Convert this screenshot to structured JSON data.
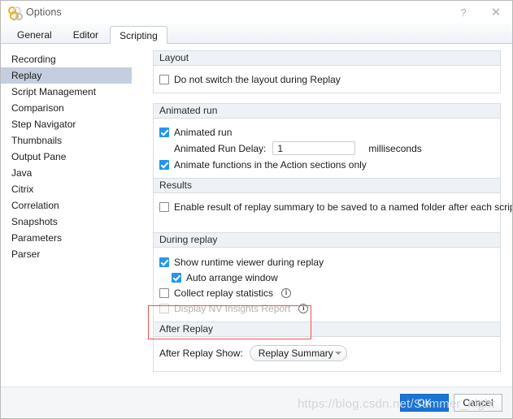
{
  "window": {
    "title": "Options",
    "icon": "vugen-rings-icon",
    "help_label": "?",
    "close_label": "✕"
  },
  "tabs": [
    {
      "label": "General",
      "active": false
    },
    {
      "label": "Editor",
      "active": false
    },
    {
      "label": "Scripting",
      "active": true
    }
  ],
  "sidebar": {
    "items": [
      {
        "label": "Recording",
        "selected": false
      },
      {
        "label": "Replay",
        "selected": true
      },
      {
        "label": "Script Management",
        "selected": false
      },
      {
        "label": "Comparison",
        "selected": false
      },
      {
        "label": "Step Navigator",
        "selected": false
      },
      {
        "label": "Thumbnails",
        "selected": false
      },
      {
        "label": "Output Pane",
        "selected": false
      },
      {
        "label": "Java",
        "selected": false
      },
      {
        "label": "Citrix",
        "selected": false
      },
      {
        "label": "Correlation",
        "selected": false
      },
      {
        "label": "Snapshots",
        "selected": false
      },
      {
        "label": "Parameters",
        "selected": false
      },
      {
        "label": "Parser",
        "selected": false
      }
    ]
  },
  "sections": {
    "layout": {
      "header": "Layout",
      "do_not_switch": {
        "label": "Do not switch the layout during Replay",
        "checked": false
      }
    },
    "animated_run": {
      "header": "Animated run",
      "animated_run": {
        "label": "Animated run",
        "checked": true
      },
      "delay": {
        "label": "Animated Run Delay:",
        "value": "1",
        "unit": "milliseconds"
      },
      "action_only": {
        "label": "Animate functions in the Action sections only",
        "checked": true
      }
    },
    "results": {
      "header": "Results",
      "enable_summary": {
        "label": "Enable result of replay summary to be saved to a named folder after each script run",
        "checked": false,
        "info": "info-icon"
      }
    },
    "during_replay": {
      "header": "During replay",
      "show_runtime_viewer": {
        "label": "Show runtime viewer during replay",
        "checked": true
      },
      "auto_arrange": {
        "label": "Auto arrange window",
        "checked": true
      },
      "collect_stats": {
        "label": "Collect replay statistics",
        "checked": false,
        "info": "info-icon"
      },
      "nv_insights": {
        "label": "Display NV Insights Report",
        "checked": false,
        "disabled": true,
        "info": "info-icon"
      }
    },
    "after_replay": {
      "header": "After Replay",
      "show_label": "After Replay Show:",
      "selected": "Replay Summary",
      "options": [
        "Replay Summary"
      ]
    }
  },
  "footer": {
    "ok_label": "OK",
    "cancel_label": "Cancel"
  },
  "overlay": {
    "watermark": "https://blog.csdn.net/Summer_night",
    "highlight_color": "#e8554d"
  },
  "colors": {
    "accent": "#1775d6",
    "checkbox_checked": "#2196f3",
    "sidebar_selected": "#c3cfe0",
    "group_header": "#eef2f7"
  }
}
